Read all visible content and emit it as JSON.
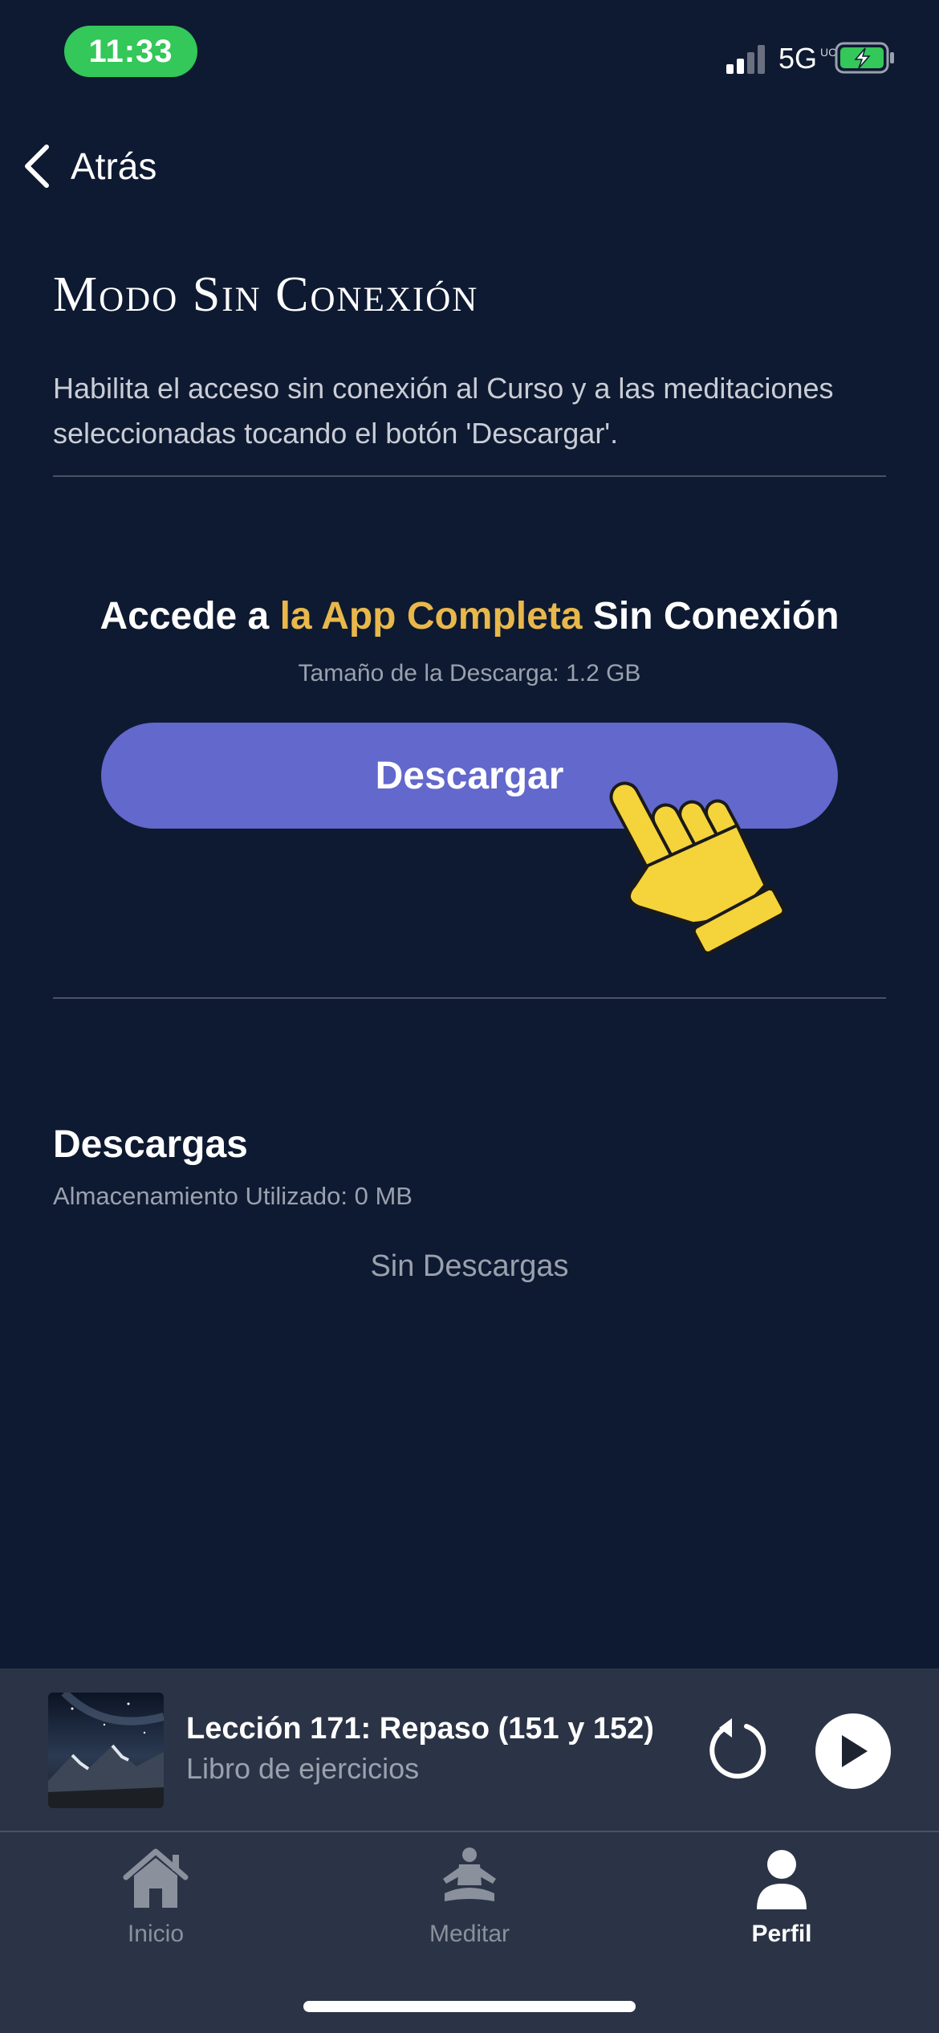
{
  "status_bar": {
    "time": "11:33",
    "network": "5G",
    "network_suffix": "UC",
    "accent_color": "#34c759"
  },
  "nav": {
    "back_label": "Atrás",
    "icon": "chevron-left-icon"
  },
  "header": {
    "title": "Modo Sin Conexión",
    "description": "Habilita el acceso sin conexión al Curso y a las meditaciones seleccionadas tocando el botón 'Descargar'."
  },
  "download_section": {
    "heading_prefix": "Accede a ",
    "heading_highlight": "la App Completa",
    "heading_suffix": " Sin Conexión",
    "size_text": "Tamaño de la Descarga: 1.2 GB",
    "button_label": "Descargar",
    "button_color": "#6268cc",
    "highlight_color": "#e9b84a",
    "pointer_icon": "pointing-hand-icon"
  },
  "downloads": {
    "title": "Descargas",
    "storage_text": "Almacenamiento Utilizado: 0 MB",
    "empty_text": "Sin Descargas"
  },
  "mini_player": {
    "title": "Lección 171: Repaso (151 y 152)",
    "subtitle": "Libro de ejercicios",
    "replay_icon": "replay-icon",
    "play_icon": "play-icon"
  },
  "tab_bar": {
    "tabs": [
      {
        "label": "Inicio",
        "icon": "home-icon",
        "active": false
      },
      {
        "label": "Meditar",
        "icon": "meditation-icon",
        "active": false
      },
      {
        "label": "Perfil",
        "icon": "profile-icon",
        "active": true
      }
    ]
  },
  "colors": {
    "background": "#0e1a31",
    "panel": "#2b3446"
  }
}
